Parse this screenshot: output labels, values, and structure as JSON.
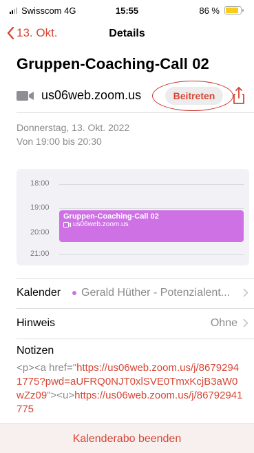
{
  "status_bar": {
    "carrier": "Swisscom 4G",
    "time": "15:55",
    "battery": "86 %",
    "battery_level": 0.86
  },
  "nav": {
    "back_label": "13. Okt.",
    "title": "Details"
  },
  "event": {
    "title": "Gruppen-Coaching-Call 02",
    "meeting_host": "us06web.zoom.us",
    "join_label": "Beitreten",
    "date": "Donnerstag, 13. Okt. 2022",
    "time_range": "Von 19:00 bis 20:30"
  },
  "day_preview": {
    "hours": [
      "18:00",
      "19:00",
      "20:00",
      "21:00"
    ],
    "event_title": "Gruppen-Coaching-Call 02",
    "event_location": "us06web.zoom.us"
  },
  "details": {
    "calendar_label": "Kalender",
    "calendar_value": "Gerald Hüther - Potenzialent...",
    "note_label": "Hinweis",
    "note_value": "Ohne",
    "notes_label": "Notizen",
    "notes_part1": "<p><a href=\"",
    "notes_link1": "https://us06web.zoom.us/j/86792941775?pwd=aUFRQ0NJT0xlSVE0TmxKcjB3aW0wZz09",
    "notes_part2": "\"><u>",
    "notes_link2": "https://us06web.zoom.us/j/86792941775"
  },
  "bottom": {
    "unsubscribe_label": "Kalenderabo beenden"
  },
  "colors": {
    "accent": "#d64534",
    "event": "#cd71e5",
    "battery": "#f7cd1a"
  }
}
